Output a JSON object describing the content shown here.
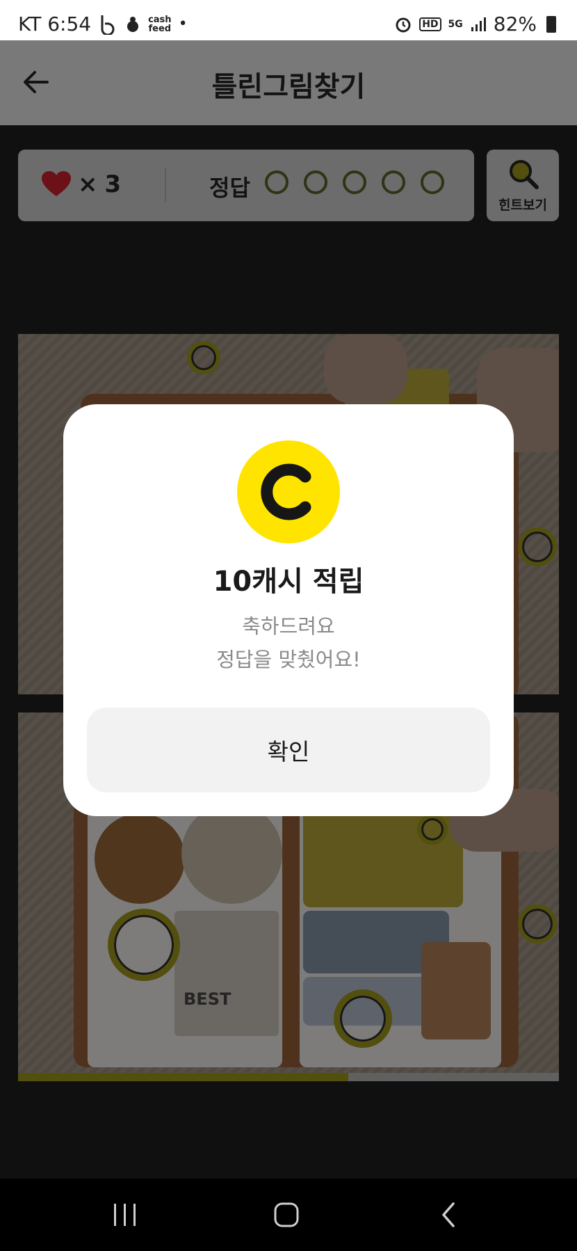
{
  "status_bar": {
    "carrier_time": "KT 6:54",
    "cash_tag_top": "cash",
    "cash_tag_bottom": "feed",
    "dot": "•",
    "hd": "HD",
    "network": "5G",
    "battery": "82%"
  },
  "header": {
    "title": "틀린그림찾기",
    "back_icon": "back-arrow-icon"
  },
  "info_panel": {
    "lives_symbol": "×",
    "lives_count": "3",
    "answer_label": "정답",
    "answers_found": 0,
    "answers_total": 5,
    "hint_label": "힌트보기"
  },
  "progress": {
    "fraction": 0.61
  },
  "modal": {
    "coin_letter": "C",
    "title": "10캐시 적립",
    "message_line1": "축하드려요",
    "message_line2": "정답을 맞췄어요!",
    "confirm_label": "확인"
  },
  "colors": {
    "accent_yellow": "#ffe400",
    "heart": "#e02a36"
  }
}
